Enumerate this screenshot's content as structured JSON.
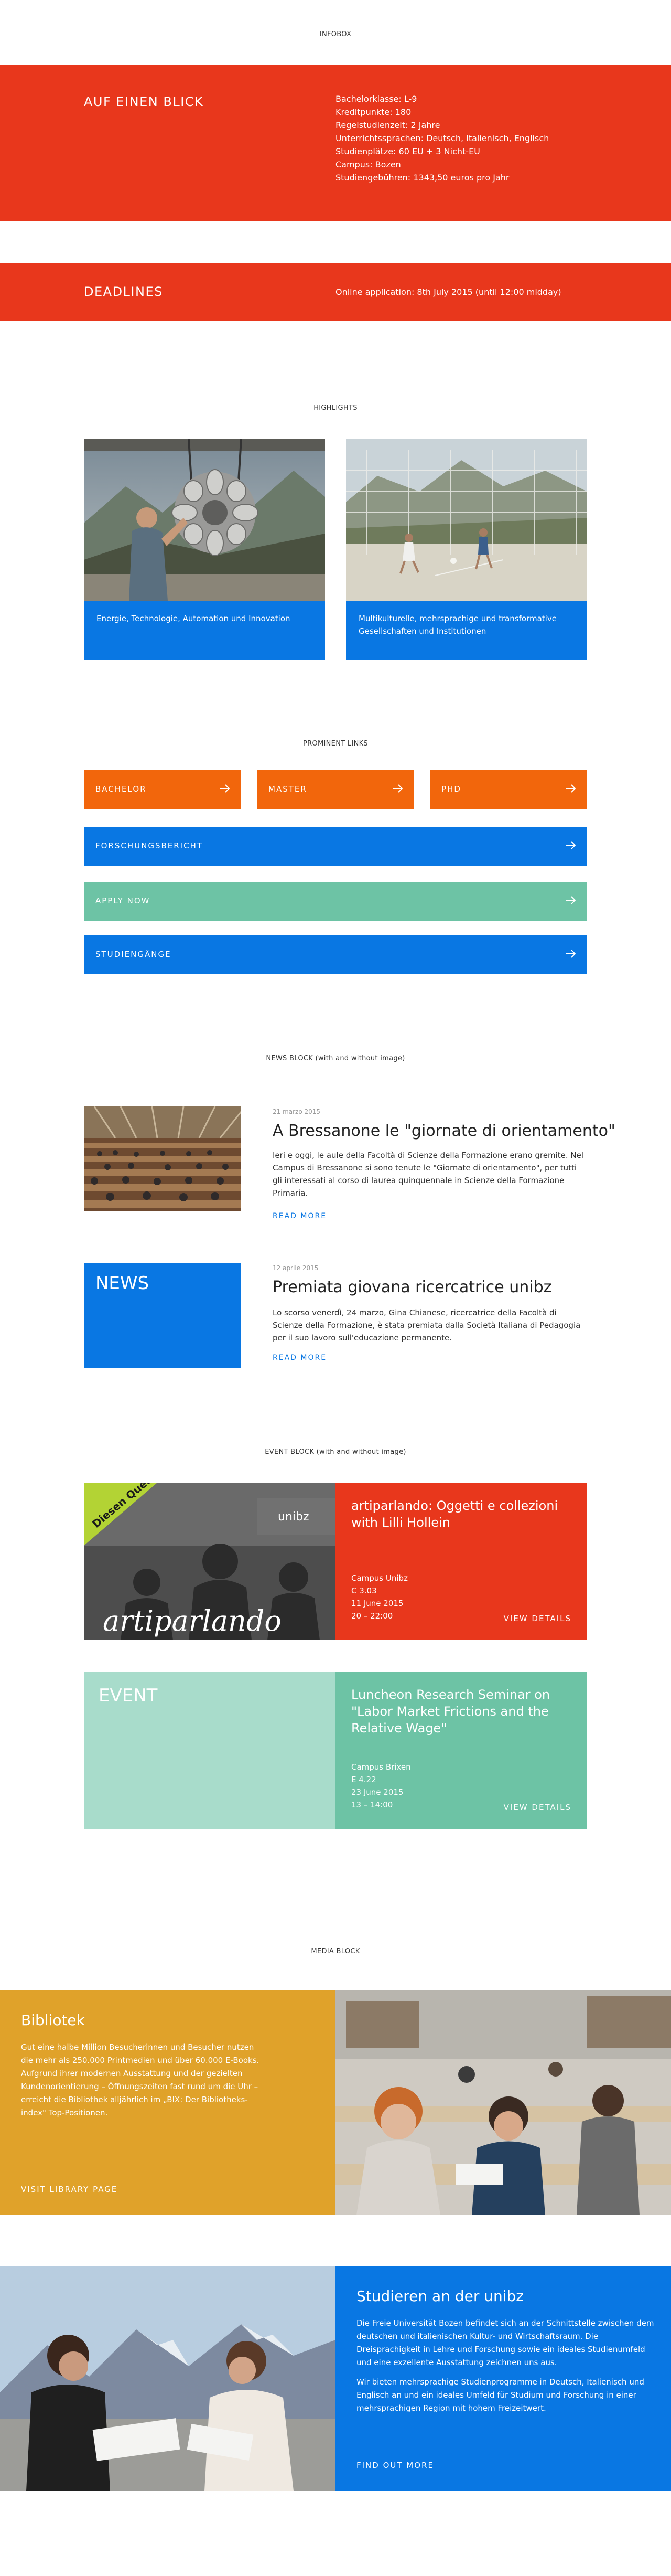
{
  "infobox": {
    "label": "INFOBOX",
    "overview_title": "AUF EINEN BLICK",
    "facts": [
      "Bachelorklasse: L-9",
      "Kreditpunkte: 180",
      "Regelstudienzeit: 2 Jahre",
      "Unterrichtssprachen: Deutsch, Italienisch, Englisch",
      "Studienplätze: 60 EU + 3 Nicht-EU",
      "Campus: Bozen",
      "Studiengebühren: 1343,50 euros pro Jahr"
    ],
    "deadlines_title": "DEADLINES",
    "deadlines_text": "Online application: 8th July 2015 (until 12:00 midday)"
  },
  "highlights": {
    "label": "HIGHLIGHTS",
    "items": [
      {
        "caption": "Energie, Technologie, Automation und Innovation"
      },
      {
        "caption": "Multikulturelle, mehrsprachige und transformative Gesellschaften und Institutionen"
      }
    ]
  },
  "prominent_links": {
    "label": "PROMINENT LINKS",
    "items": [
      {
        "label": "BACHELOR"
      },
      {
        "label": "MASTER"
      },
      {
        "label": "PHD"
      },
      {
        "label": "FORSCHUNGSBERICHT"
      },
      {
        "label": "APPLY NOW"
      },
      {
        "label": "STUDIENGÄNGE"
      }
    ]
  },
  "news": {
    "label": "NEWS BLOCK (with and without image)",
    "placeholder_label": "NEWS",
    "items": [
      {
        "date": "21 marzo 2015",
        "title": "A Bressanone le \"giornate di orientamento\"",
        "body": "Ieri e oggi, le aule della Facoltà di Scienze della Formazione erano gremite. Nel Campus di Bressanone si sono tenute le \"Giornate di orientamento\", per tutti gli interessati al corso di laurea quinquennale in Scienze della Formazione Primaria.",
        "more": "READ MORE"
      },
      {
        "date": "12 aprile 2015",
        "title": "Premiata giovana ricercatrice unibz",
        "body": "Lo scorso venerdì, 24 marzo, Gina Chianese, ricercatrice della Facoltà di Scienze della Formazione, è stata premiata dalla Società Italiana di Pedagogia per il suo lavoro sull'educazione permanente.",
        "more": "READ MORE"
      }
    ]
  },
  "events": {
    "label": "EVENT BLOCK (with and without image)",
    "placeholder_label": "EVENT",
    "image_texts": {
      "brand": "unibz",
      "wordmark": "artiparlando",
      "banner": "Diesen Questo"
    },
    "items": [
      {
        "title": "artiparlando: Oggetti e collezioni with Lilli Hollein",
        "location": "Campus Unibz",
        "room": "C 3.03",
        "date": "11 June 2015",
        "time": "20 – 22:00",
        "more": "VIEW DETAILS"
      },
      {
        "title": "Luncheon Research Seminar on \"Labor Market Frictions and the Relative Wage\"",
        "location": "Campus Brixen",
        "room": "E 4.22",
        "date": "23 June 2015",
        "time": "13 – 14:00",
        "more": "VIEW DETAILS"
      }
    ]
  },
  "media": {
    "label": "MEDIA BLOCK",
    "items": [
      {
        "title": "Bibliotek",
        "body": "Gut eine halbe Million Besucherinnen und Besucher nutzen die mehr als 250.000 Printmedien und über 60.000 E-Books. Aufgrund ihrer modernen Ausstattung und der gezielten Kundenorientierung – Öffnungszeiten fast rund um die Uhr – erreicht die Bibliothek alljährlich im „BIX: Der Bibliotheks-index\" Top-Positionen.",
        "more": "VISIT LIBRARY PAGE"
      },
      {
        "title": "Studieren an der unibz",
        "body": "Die Freie Universität Bozen befindet sich an der Schnittstelle zwischen dem deutschen und italienischen Kultur- und Wirtschaftsraum. Die Dreisprachigkeit in Lehre und Forschung sowie ein ideales Studienumfeld und eine exzellente Ausstattung zeichnen uns aus.",
        "body2": "Wir bieten mehrsprachige Studienprogramme in Deutsch, Italienisch und Englisch an und ein ideales Umfeld für Studium und Forschung in einer mehrsprachigen Region mit hohem Freizeitwert.",
        "more": "FIND OUT MORE"
      }
    ]
  },
  "colors": {
    "red": "#e8371c",
    "blue": "#0977e3",
    "orange": "#f2660c",
    "green": "#6dc3a5",
    "mint": "#a8dccb",
    "mustard": "#e0a22a"
  }
}
